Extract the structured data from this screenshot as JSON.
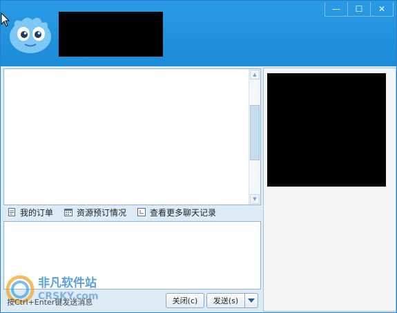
{
  "window": {
    "controls": {
      "minimize": "—",
      "maximize": "☐",
      "close": "✕"
    }
  },
  "toolbar": {
    "items": [
      {
        "label": "我的订单",
        "icon": "document-icon"
      },
      {
        "label": "资源预订情况",
        "icon": "calendar-icon"
      },
      {
        "label": "查看更多聊天记录",
        "icon": "history-icon"
      }
    ]
  },
  "footer": {
    "hint": "按Ctrl+Enter键发送消息",
    "close_label": "关闭(c)",
    "send_label": "发送(s)",
    "watermark_line1": "非凡软件站",
    "watermark_line2": "CRSKY.com"
  },
  "colors": {
    "titlebar": "#1b8bd9",
    "panel": "#dcebf6",
    "accent": "#2a9be6"
  }
}
